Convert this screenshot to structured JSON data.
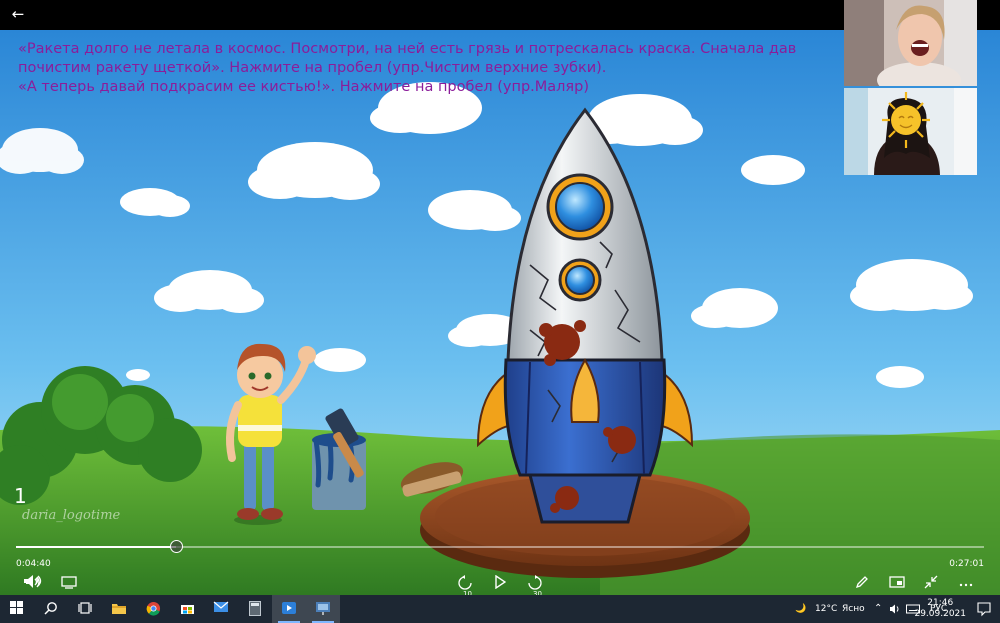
{
  "window": {
    "back_label": "←"
  },
  "slide": {
    "lines": [
      "«Ракета долго не летала в космос. Посмотри, на ней есть грязь и потрескалась краска. Сначала дав",
      "почистим ракету щеткой». Нажмите на пробел (упр.Чистим верхние зубки).",
      "«А теперь давай подкрасим ее кистью!». Нажмите на пробел (упр.Маляр)"
    ],
    "slide_number": "1",
    "watermark": "daria_logotime"
  },
  "player": {
    "current_time": "0:04:40",
    "duration": "0:27:01",
    "progress_fraction": 0.165,
    "skip_back_label": "10",
    "skip_forward_label": "30"
  },
  "taskbar": {
    "temperature": "12°C",
    "weather": "Ясно",
    "language": "РУС",
    "time": "21:46",
    "date": "29.09.2021"
  },
  "colors": {
    "slide_text": "#8b1d9a",
    "taskbar": "#1d2733",
    "sky_top": "#2f8fd8",
    "grass": "#3f8a2a"
  }
}
